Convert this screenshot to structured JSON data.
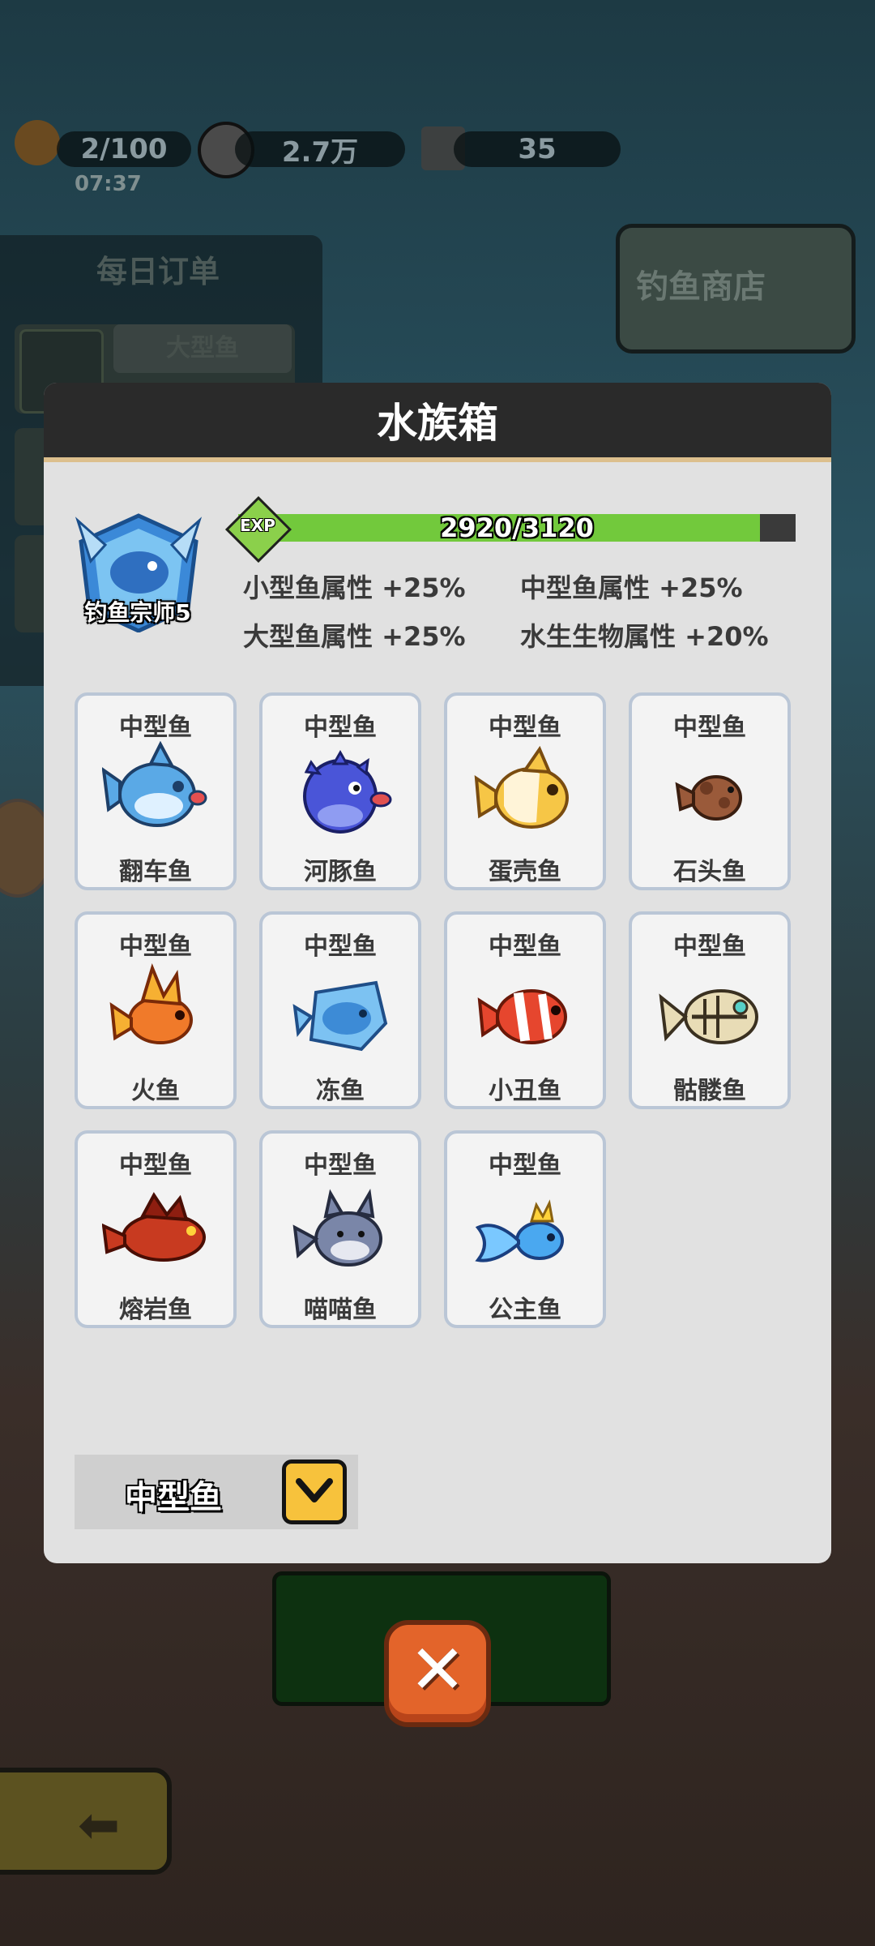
{
  "hud": {
    "bait": "2/100",
    "timer": "07:37",
    "coins": "2.7万",
    "hammers": "35"
  },
  "background": {
    "daily_orders_title": "每日订单",
    "daily_order_item": "大型鱼",
    "shop_button": "钓鱼商店"
  },
  "aquarium": {
    "title": "水族箱",
    "rank": "钓鱼宗师5",
    "exp_label": "EXP",
    "exp_text": "2920/3120",
    "exp_fraction": 0.936,
    "attributes": [
      "小型鱼属性 +25%",
      "中型鱼属性 +25%",
      "大型鱼属性 +25%",
      "水生生物属性 +20%"
    ],
    "fish": [
      {
        "category": "中型鱼",
        "name": "翻车鱼"
      },
      {
        "category": "中型鱼",
        "name": "河豚鱼"
      },
      {
        "category": "中型鱼",
        "name": "蛋壳鱼"
      },
      {
        "category": "中型鱼",
        "name": "石头鱼"
      },
      {
        "category": "中型鱼",
        "name": "火鱼"
      },
      {
        "category": "中型鱼",
        "name": "冻鱼"
      },
      {
        "category": "中型鱼",
        "name": "小丑鱼"
      },
      {
        "category": "中型鱼",
        "name": "骷髅鱼"
      },
      {
        "category": "中型鱼",
        "name": "熔岩鱼"
      },
      {
        "category": "中型鱼",
        "name": "喵喵鱼"
      },
      {
        "category": "中型鱼",
        "name": "公主鱼"
      }
    ],
    "filter": "中型鱼"
  },
  "colors": {
    "exp_fill": "#72c93c",
    "close_button": "#e3642a",
    "toggle": "#f7c23c"
  }
}
